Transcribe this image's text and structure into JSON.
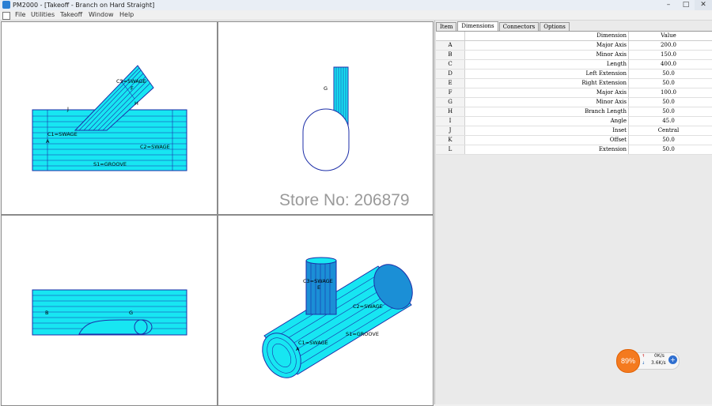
{
  "window": {
    "title": "PM2000 - [Takeoff - Branch on Hard Straight]"
  },
  "window_controls": {
    "minimize": "–",
    "maximize": "□",
    "close": "✕"
  },
  "menu": {
    "items": [
      "File",
      "Utilities",
      "Takeoff",
      "Window",
      "Help"
    ]
  },
  "viewports": {
    "front": {
      "labels": {
        "c3": "C3=SWAGE",
        "f": "F",
        "h": "H",
        "j": "J",
        "c1": "C1=SWAGE",
        "a": "A",
        "c2": "C2=SWAGE",
        "s1": "S1=GROOVE"
      }
    },
    "side": {
      "labels": {
        "g": "G"
      }
    },
    "top": {
      "labels": {
        "b": "B",
        "g": "G"
      }
    },
    "iso": {
      "labels": {
        "c3": "C3=SWAGE",
        "e": "E",
        "c2": "C2=SWAGE",
        "c1": "C1=SWAGE",
        "a": "A",
        "s1": "S1=GROOVE"
      }
    }
  },
  "panel": {
    "tabs": [
      "Item",
      "Dimensions",
      "Connectors",
      "Options"
    ],
    "active_tab": "Dimensions",
    "columns": {
      "dimension": "Dimension",
      "value": "Value"
    },
    "rows": [
      {
        "key": "A",
        "dimension": "Major Axis",
        "value": "200.0"
      },
      {
        "key": "B",
        "dimension": "Minor Axis",
        "value": "150.0"
      },
      {
        "key": "C",
        "dimension": "Length",
        "value": "400.0"
      },
      {
        "key": "D",
        "dimension": "Left Extension",
        "value": "50.0"
      },
      {
        "key": "E",
        "dimension": "Right Extension",
        "value": "50.0"
      },
      {
        "key": "F",
        "dimension": "Major Axis",
        "value": "100.0"
      },
      {
        "key": "G",
        "dimension": "Minor Axis",
        "value": "50.0"
      },
      {
        "key": "H",
        "dimension": "Branch Length",
        "value": "50.0"
      },
      {
        "key": "I",
        "dimension": "Angle",
        "value": "45.0"
      },
      {
        "key": "J",
        "dimension": "Inset",
        "value": "Central"
      },
      {
        "key": "K",
        "dimension": "Offset",
        "value": "50.0"
      },
      {
        "key": "L",
        "dimension": "Extension",
        "value": "50.0"
      }
    ]
  },
  "watermark": "Store No: 206879",
  "net_meter": {
    "percent": "89%",
    "upload": "0K/s",
    "download": "3.6K/s",
    "up_arrow": "↑",
    "down_arrow": "↓",
    "boost": "+"
  },
  "colors": {
    "pipe_fill": "#17e6f2",
    "pipe_line": "#1c2ea8",
    "pipe_shade": "#1b8fd6"
  }
}
